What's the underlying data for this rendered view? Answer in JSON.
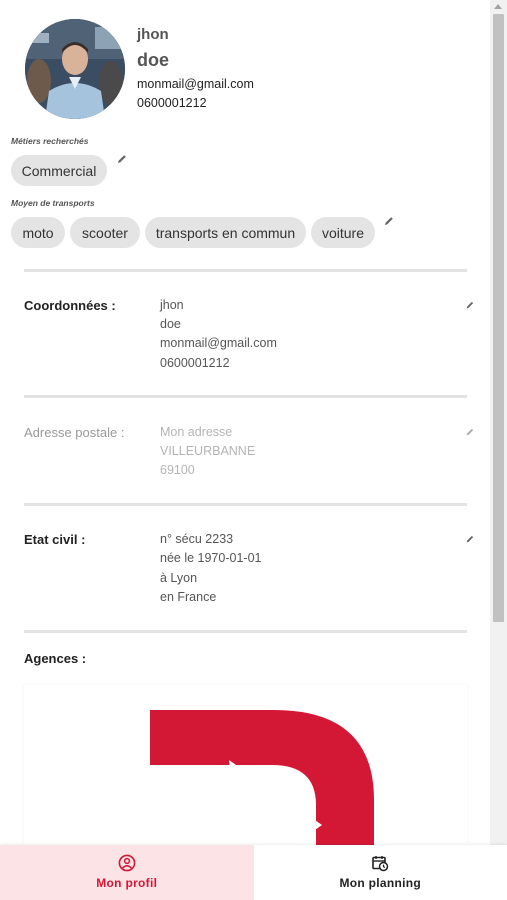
{
  "profile": {
    "first_name": "jhon",
    "last_name": "doe",
    "email": "monmail@gmail.com",
    "phone": "0600001212"
  },
  "metiers": {
    "label": "Métiers recherchés",
    "items": [
      "Commercial"
    ]
  },
  "transports": {
    "label": "Moyen de transports",
    "items": [
      "moto",
      "scooter",
      "transports en commun",
      "voiture"
    ]
  },
  "coordonnees": {
    "label": "Coordonnées :",
    "lines": [
      "jhon",
      "doe",
      "monmail@gmail.com",
      "0600001212"
    ]
  },
  "adresse": {
    "label": "Adresse postale :",
    "lines": [
      "Mon adresse",
      "VILLEURBANNE",
      "69100"
    ]
  },
  "etat_civil": {
    "label": "Etat civil :",
    "lines": [
      "n° sécu 2233",
      "née le 1970-01-01",
      "à Lyon",
      "en France"
    ]
  },
  "agences": {
    "label": "Agences :"
  },
  "nav": {
    "items": [
      {
        "label": "Mon profil",
        "icon": "user-circle-icon",
        "active": true
      },
      {
        "label": "Mon planning",
        "icon": "calendar-clock-icon",
        "active": false
      }
    ]
  },
  "colors": {
    "accent": "#d31835",
    "active_tab_bg": "#fbe3e6",
    "chip_bg": "#e4e4e4"
  }
}
